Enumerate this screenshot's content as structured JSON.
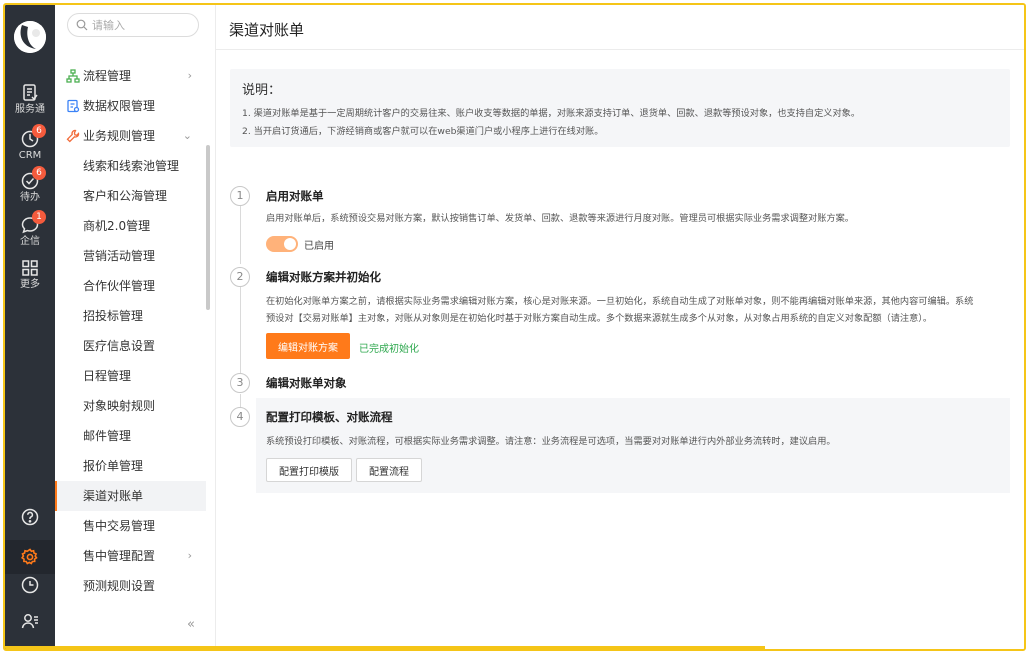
{
  "rail": {
    "items": [
      {
        "label": "服务通",
        "icon": "document-check-icon",
        "badge": ""
      },
      {
        "label": "CRM",
        "icon": "crm-clock-icon",
        "badge": "6"
      },
      {
        "label": "待办",
        "icon": "todo-check-icon",
        "badge": "6"
      },
      {
        "label": "企信",
        "icon": "chat-bubble-icon",
        "badge": "1"
      },
      {
        "label": "更多",
        "icon": "grid-icon",
        "badge": ""
      }
    ],
    "bottom_icons": [
      "help-icon",
      "settings-gear-icon",
      "history-clock-icon",
      "contacts-icon"
    ],
    "accent": "#ff7a1a"
  },
  "menu": {
    "search_placeholder": "请输入",
    "items": [
      {
        "label": "流程管理",
        "level": "top",
        "arrow": "›"
      },
      {
        "label": "数据权限管理",
        "level": "top",
        "arrow": ""
      },
      {
        "label": "业务规则管理",
        "level": "top",
        "arrow": "⌄"
      },
      {
        "label": "线索和线索池管理",
        "level": "sub",
        "arrow": ""
      },
      {
        "label": "客户和公海管理",
        "level": "sub",
        "arrow": ""
      },
      {
        "label": "商机2.0管理",
        "level": "sub",
        "arrow": ""
      },
      {
        "label": "营销活动管理",
        "level": "sub",
        "arrow": ""
      },
      {
        "label": "合作伙伴管理",
        "level": "sub",
        "arrow": ""
      },
      {
        "label": "招投标管理",
        "level": "sub",
        "arrow": ""
      },
      {
        "label": "医疗信息设置",
        "level": "sub",
        "arrow": ""
      },
      {
        "label": "日程管理",
        "level": "sub",
        "arrow": ""
      },
      {
        "label": "对象映射规则",
        "level": "sub",
        "arrow": ""
      },
      {
        "label": "邮件管理",
        "level": "sub",
        "arrow": ""
      },
      {
        "label": "报价单管理",
        "level": "sub",
        "arrow": ""
      },
      {
        "label": "渠道对账单",
        "level": "sub",
        "arrow": "",
        "selected": true
      },
      {
        "label": "售中交易管理",
        "level": "sub",
        "arrow": ""
      },
      {
        "label": "售中管理配置",
        "level": "sub",
        "arrow": "›"
      },
      {
        "label": "预测规则设置",
        "level": "sub",
        "arrow": ""
      }
    ],
    "collapse_label": "«"
  },
  "main": {
    "title": "渠道对账单",
    "note": {
      "title": "说明：",
      "lines": [
        "1. 渠道对账单是基于一定周期统计客户的交易往来、账户收支等数据的单据，对账来源支持订单、退货单、回款、退款等预设对象，也支持自定义对象。",
        "2. 当开启订货通后，下游经销商或客户就可以在web渠道门户或小程序上进行在线对账。"
      ]
    },
    "steps": [
      {
        "num": "1",
        "title": "启用对账单",
        "desc": [
          "启用对账单后，系统预设交易对账方案，默认按销售订单、发货单、回款、退款等来源进行月度对账。管理员可根据实际业务需求调整对账方案。"
        ],
        "toggle_label": "已启用",
        "toggle_on": true
      },
      {
        "num": "2",
        "title": "编辑对账方案并初始化",
        "desc": [
          "在初始化对账单方案之前，请根据实际业务需求编辑对账方案，核心是对账来源。一旦初始化，系统自动生成了对账单对象，则不能再编辑对账单来源，其他内容可编辑。系统",
          "预设对【交易对账单】主对象，对账从对象则是在初始化时基于对账方案自动生成。多个数据来源就生成多个从对象，从对象占用系统的自定义对象配额（请注意）。"
        ],
        "button": "编辑对账方案",
        "status": "已完成初始化"
      },
      {
        "num": "3",
        "title": "编辑对账单对象"
      },
      {
        "num": "4",
        "title": "配置打印模板、对账流程",
        "desc": [
          "系统预设打印模板、对账流程，可根据实际业务需求调整。请注意：业务流程是可选项，当需要对对账单进行内外部业务流转时，建议启用。"
        ],
        "buttons": [
          "配置打印模版",
          "配置流程"
        ]
      }
    ],
    "done_color": "#2fa84f"
  }
}
